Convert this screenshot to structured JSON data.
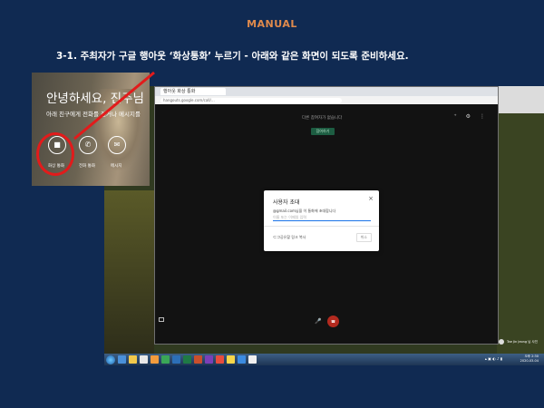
{
  "header": {
    "title": "MANUAL",
    "instruction": "3-1. 주최자가 구글 행아웃 ‘화상통화’ 누르기 - 아래와 같은 화면이 되도록 준비하세요."
  },
  "inset": {
    "greeting": "안녕하세요, 진주님",
    "subtitle": "아래 친구에게 전화를 걸거나 메시지를",
    "buttons": [
      {
        "label": "화상 통화",
        "icon": "video-camera-icon"
      },
      {
        "label": "전화 통화",
        "icon": "phone-icon"
      },
      {
        "label": "메시지",
        "icon": "chat-icon"
      }
    ]
  },
  "browser": {
    "tab_title": "행아웃 화상 통화",
    "url": "hangouts.google.com/call/...",
    "meeting_message": "다른 참여자가 없습니다",
    "join_label": "참여하기"
  },
  "dialog": {
    "title": "사용자 초대",
    "subtitle": "@gmail.com님을 이 통화에 초대합니다",
    "input_placeholder": "이름 또는 이메일 입력",
    "share_link_label": "공유할 링크 복사",
    "cancel_label": "취소"
  },
  "taskbar": {
    "user_name": "Tae Jin Jeong 님 사진",
    "clock_time": "오후 2:30",
    "clock_date": "2020-03-04"
  },
  "colors": {
    "background": "#102a52",
    "title_accent": "#e08a4c",
    "highlight": "#e21b1b"
  }
}
